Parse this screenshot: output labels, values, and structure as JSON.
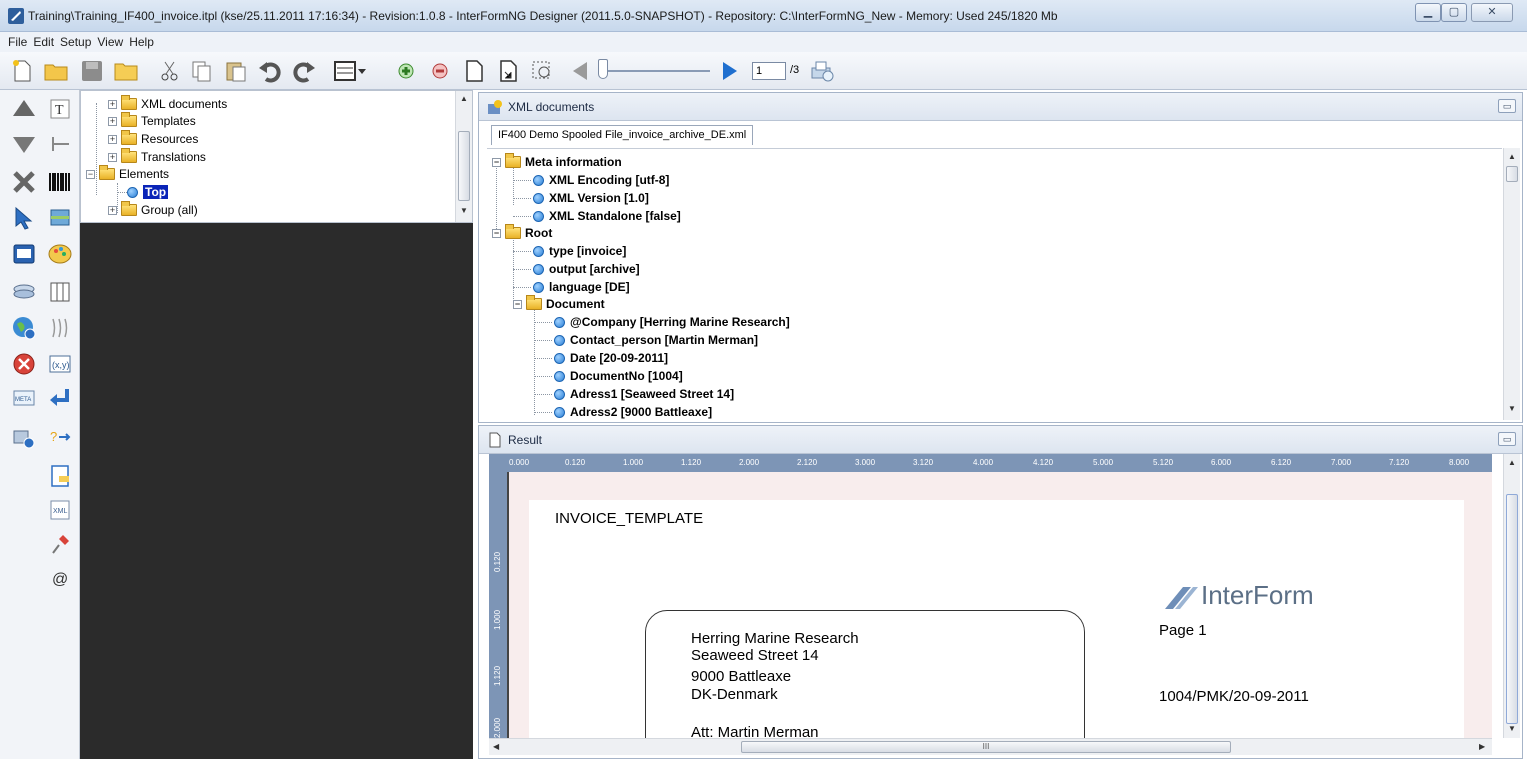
{
  "window": {
    "title": "Training\\Training_IF400_invoice.itpl (kse/25.11.2011 17:16:34) - Revision:1.0.8 - InterFormNG Designer (2011.5.0-SNAPSHOT) - Repository: C:\\InterFormNG_New - Memory: Used 245/1820 Mb"
  },
  "menu": [
    "File",
    "Edit",
    "Setup",
    "View",
    "Help"
  ],
  "toolbar": {
    "page_current": "1",
    "page_total": "/3"
  },
  "project_tree": {
    "items": [
      {
        "label": "XML documents",
        "type": "folder",
        "level": 1,
        "expander": "+"
      },
      {
        "label": "Templates",
        "type": "folder",
        "level": 1,
        "expander": "+"
      },
      {
        "label": "Resources",
        "type": "folder",
        "level": 1,
        "expander": "+"
      },
      {
        "label": "Translations",
        "type": "folder",
        "level": 1,
        "expander": "+"
      },
      {
        "label": "Elements",
        "type": "folder",
        "level": 0,
        "expander": "−"
      },
      {
        "label": "Top",
        "type": "node",
        "level": 1,
        "selected": true
      },
      {
        "label": "Group (all)",
        "type": "folder",
        "level": 1,
        "expander": "+"
      }
    ]
  },
  "xml_panel": {
    "title": "XML documents",
    "tab": "IF400 Demo Spooled File_invoice_archive_DE.xml",
    "items": [
      {
        "label": "Meta information",
        "type": "folder",
        "level": 0
      },
      {
        "label": "XML Encoding [utf-8]",
        "type": "node",
        "level": 1
      },
      {
        "label": "XML Version [1.0]",
        "type": "node",
        "level": 1
      },
      {
        "label": "XML Standalone [false]",
        "type": "node",
        "level": 1
      },
      {
        "label": "Root",
        "type": "folder",
        "level": 0
      },
      {
        "label": "type [invoice]",
        "type": "node",
        "level": 1
      },
      {
        "label": "output [archive]",
        "type": "node",
        "level": 1
      },
      {
        "label": "language [DE]",
        "type": "node",
        "level": 1
      },
      {
        "label": "Document",
        "type": "folder",
        "level": 1
      },
      {
        "label": "@Company [Herring Marine Research]",
        "type": "node",
        "level": 2
      },
      {
        "label": "Contact_person [Martin Merman]",
        "type": "node",
        "level": 2
      },
      {
        "label": "Date [20-09-2011]",
        "type": "node",
        "level": 2
      },
      {
        "label": "DocumentNo [1004]",
        "type": "node",
        "level": 2
      },
      {
        "label": "Adress1 [Seaweed Street 14]",
        "type": "node",
        "level": 2
      },
      {
        "label": "Adress2 [9000 Battleaxe]",
        "type": "node",
        "level": 2
      }
    ]
  },
  "result_panel": {
    "title": "Result",
    "ruler_h": [
      "0.000",
      "0.120",
      "1.000",
      "1.120",
      "2.000",
      "2.120",
      "3.000",
      "3.120",
      "4.000",
      "4.120",
      "5.000",
      "5.120",
      "6.000",
      "6.120",
      "7.000",
      "7.120",
      "8.000"
    ],
    "ruler_v": [
      "0.120",
      "1.000",
      "1.120",
      "2.000"
    ],
    "invoice": {
      "template_title": "INVOICE_TEMPLATE",
      "logo_text": "InterForm",
      "page_label": "Page 1",
      "reference": "1004/PMK/20-09-2011",
      "address_lines": [
        "Herring Marine Research",
        "Seaweed Street 14",
        "9000 Battleaxe",
        "DK-Denmark",
        "Att: Martin Merman"
      ]
    },
    "hscroll_thumb": "III"
  },
  "colors": {
    "selection": "#0a24b8",
    "ruler": "#7d95b6",
    "workspace": "#2b2b2b",
    "page_margin": "#f8eded"
  }
}
